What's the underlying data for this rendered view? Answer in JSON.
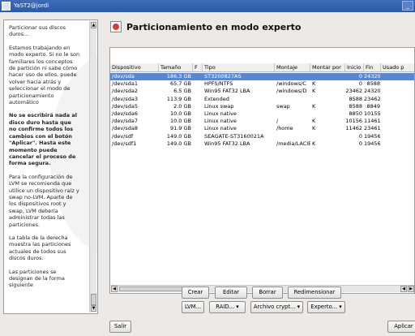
{
  "window": {
    "title": "YaST2@jordi"
  },
  "help": {
    "paragraphs": [
      "Particionar sus discos duros...",
      "Estamos trabajando en modo experto. Si no le son familiares los conceptos de partición ni sabe cómo hacer uso de ellos, puede volver hacia atrás y seleccionar el modo de particionamiento automático",
      "No se escribirá nada al disco duro hasta que no confirme todos los cambios con el botón \"Aplicar\". Hasta este momento puede cancelar el proceso de forma segura.",
      "Para la configuración de LVM se recomienda que utilice un dispositivo raíz y swap no-LVM. Aparte de los dispositivos root y swap, LVM debería administrar todas las particiones.",
      "La tabla de la derecha muestra las particiones actuales de todos sus discos duros.",
      "Las particiones se designan de la forma siguiente"
    ]
  },
  "main": {
    "title": "Particionamiento en modo experto"
  },
  "table": {
    "columns": [
      "Dispositivo",
      "Tamaño",
      "F",
      "Tipo",
      "Montaje",
      "Montar por",
      "Inicio",
      "Fin",
      "Usado p"
    ],
    "rows": [
      {
        "device": "/dev/sda",
        "size": "186.3 GB",
        "f": "",
        "type": "ST3200827AS",
        "mount": "",
        "by": "",
        "start": "0",
        "end": "24320",
        "used": "",
        "selected": true
      },
      {
        "device": "/dev/sda1",
        "size": "65.7 GB",
        "f": "",
        "type": "HPFS/NTFS",
        "mount": "/windows/C",
        "by": "K",
        "start": "0",
        "end": "8588",
        "used": ""
      },
      {
        "device": "/dev/sda2",
        "size": "6.5 GB",
        "f": "",
        "type": "Win95 FAT32 LBA",
        "mount": "/windows/D",
        "by": "K",
        "start": "23462",
        "end": "24320",
        "used": ""
      },
      {
        "device": "/dev/sda3",
        "size": "113.9 GB",
        "f": "",
        "type": "Extended",
        "mount": "",
        "by": "",
        "start": "8588",
        "end": "23462",
        "used": ""
      },
      {
        "device": "/dev/sda5",
        "size": "2.0 GB",
        "f": "",
        "type": "Linux swap",
        "mount": "swap",
        "by": "K",
        "start": "8588",
        "end": "8849",
        "used": ""
      },
      {
        "device": "/dev/sda6",
        "size": "10.0 GB",
        "f": "",
        "type": "Linux native",
        "mount": "",
        "by": "",
        "start": "8850",
        "end": "10155",
        "used": ""
      },
      {
        "device": "/dev/sda7",
        "size": "10.0 GB",
        "f": "",
        "type": "Linux native",
        "mount": "/",
        "by": "K",
        "start": "10156",
        "end": "11461",
        "used": ""
      },
      {
        "device": "/dev/sda8",
        "size": "91.9 GB",
        "f": "",
        "type": "Linux native",
        "mount": "/home",
        "by": "K",
        "start": "11462",
        "end": "23461",
        "used": ""
      },
      {
        "device": "/dev/sdf",
        "size": "149.0 GB",
        "f": "",
        "type": "SEAGATE-ST3160021A",
        "mount": "",
        "by": "",
        "start": "0",
        "end": "19456",
        "used": ""
      },
      {
        "device": "/dev/sdf1",
        "size": "149.0 GB",
        "f": "",
        "type": "Win95 FAT32 LBA",
        "mount": "/media/LACIE",
        "by": "K",
        "start": "0",
        "end": "19456",
        "used": ""
      }
    ]
  },
  "buttons": {
    "create": "Crear",
    "edit": "Editar",
    "delete": "Borrar",
    "resize": "Redimensionar",
    "lvm": "LVM...",
    "raid": "RAID...",
    "crypt": "Archivo crypt...",
    "expert": "Experto...",
    "quit": "Salir",
    "apply": "Aplicar"
  }
}
